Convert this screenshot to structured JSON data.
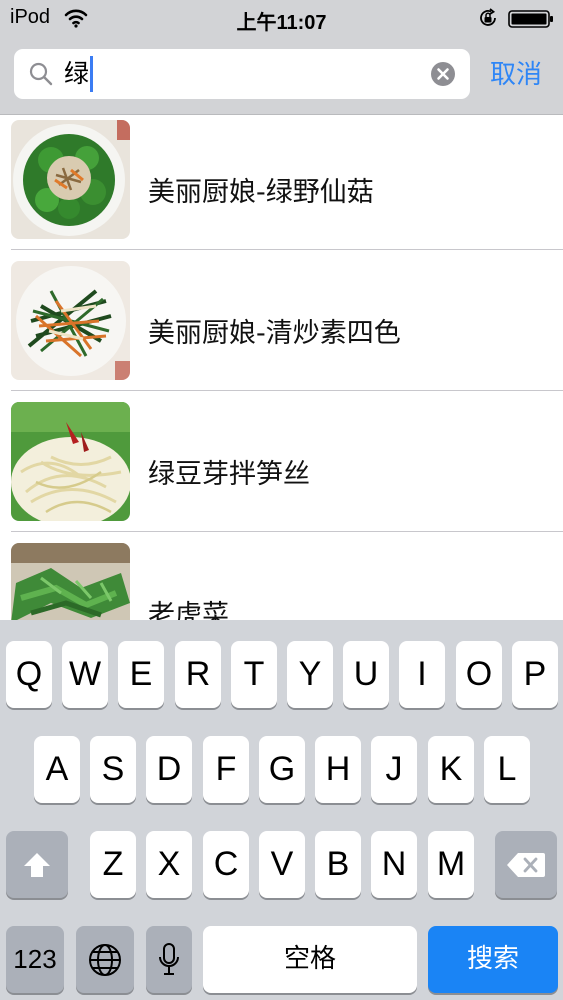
{
  "status_bar": {
    "device": "iPod",
    "time": "上午11:07",
    "icons": [
      "wifi-icon",
      "rotation-lock-icon",
      "battery-icon"
    ]
  },
  "search": {
    "query": "绿",
    "cancel_label": "取消",
    "icons": [
      "search-icon",
      "clear-icon"
    ]
  },
  "results": [
    {
      "title": "美丽厨娘-绿野仙菇"
    },
    {
      "title": "美丽厨娘-清炒素四色"
    },
    {
      "title": "绿豆芽拌笋丝"
    },
    {
      "title": "老虎菜"
    }
  ],
  "keyboard": {
    "row1": [
      "Q",
      "W",
      "E",
      "R",
      "T",
      "Y",
      "U",
      "I",
      "O",
      "P"
    ],
    "row2": [
      "A",
      "S",
      "D",
      "F",
      "G",
      "H",
      "J",
      "K",
      "L"
    ],
    "row3": [
      "Z",
      "X",
      "C",
      "V",
      "B",
      "N",
      "M"
    ],
    "numbers_label": "123",
    "space_label": "空格",
    "search_label": "搜索",
    "icons": [
      "shift-icon",
      "backspace-icon",
      "globe-icon",
      "microphone-icon"
    ]
  },
  "colors": {
    "accent": "#2f86f6",
    "search_key": "#1a84f5",
    "keyboard_bg": "#d1d4d9",
    "header_bg": "#d2d3d6"
  }
}
